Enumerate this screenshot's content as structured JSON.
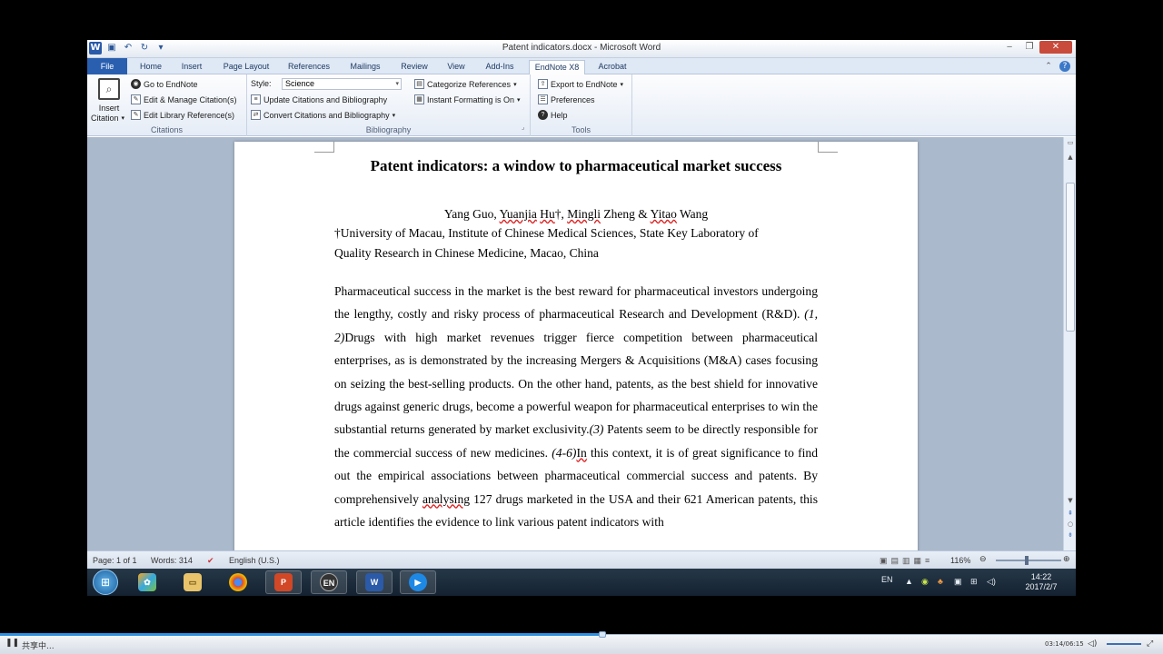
{
  "window": {
    "title": "Patent indicators.docx - Microsoft Word",
    "minimize": "‒",
    "maximize": "❐",
    "close": "✕"
  },
  "tabs": [
    "File",
    "Home",
    "Insert",
    "Page Layout",
    "References",
    "Mailings",
    "Review",
    "View",
    "Add-Ins",
    "EndNote X8",
    "Acrobat"
  ],
  "ribbon": {
    "citations": {
      "insert_line1": "Insert",
      "insert_line2": "Citation",
      "go_to_endnote": "Go to EndNote",
      "edit_manage": "Edit & Manage Citation(s)",
      "edit_library": "Edit Library Reference(s)",
      "group_label": "Citations"
    },
    "bibliography": {
      "style_label": "Style:",
      "style_value": "Science",
      "update": "Update Citations and Bibliography",
      "convert": "Convert Citations and Bibliography",
      "categorize": "Categorize References",
      "instant": "Instant Formatting is On",
      "group_label": "Bibliography"
    },
    "tools": {
      "export": "Export to EndNote",
      "preferences": "Preferences",
      "help": "Help",
      "group_label": "Tools"
    }
  },
  "document": {
    "title": "Patent indicators: a window to pharmaceutical market success",
    "authors": {
      "a1": "Yang Guo, ",
      "a2": "Yuanjia",
      "a3": " ",
      "a4": "Hu",
      "a5": "†, ",
      "a6": "Mingli",
      "a7": " Zheng & ",
      "a8": "Yitao",
      "a9": " Wang"
    },
    "affiliation_line1": "†University of Macau, Institute of Chinese Medical Sciences, State Key Laboratory of",
    "affiliation_line2": "Quality Research in Chinese Medicine, Macao, China",
    "abstract": {
      "p1": "Pharmaceutical success in the market is the best reward for pharmaceutical investors undergoing the lengthy, costly and risky process of pharmaceutical Research and Development (R&D). ",
      "c1": "(1, 2)",
      "p2": "Drugs with high market revenues trigger fierce competition between pharmaceutical enterprises, as is demonstrated by the increasing Mergers & Acquisitions (M&A) cases focusing on seizing the best-selling products. On the other hand, patents, as the best shield for innovative drugs against generic drugs, become a powerful weapon for pharmaceutical enterprises to win the substantial returns generated by market exclusivity.",
      "c2": "(3)",
      "p3": " Patents seem to be directly responsible for the commercial success of new medicines. ",
      "c3": "(4-6)",
      "p4": "In",
      "p5": " this context, it is of great significance to find out the empirical associations between pharmaceutical commercial success and patents. By comprehensively ",
      "p6": "analysing",
      "p7": " 127 drugs marketed in the USA and their 621 American patents, this article identifies the evidence to link various patent indicators with"
    }
  },
  "status": {
    "page": "Page: 1 of 1",
    "words": "Words: 314",
    "language": "English (U.S.)",
    "zoom": "116%"
  },
  "taskbar": {
    "lang": "EN",
    "time": "14:22",
    "date": "2017/2/7",
    "apps": [
      "windows-explorer",
      "photos",
      "file-explorer",
      "chrome",
      "powerpoint",
      "endnote",
      "word",
      "media-player"
    ]
  },
  "player": {
    "status": "共享中...",
    "time": "03:14/06:15",
    "progress_fraction": 0.518
  }
}
